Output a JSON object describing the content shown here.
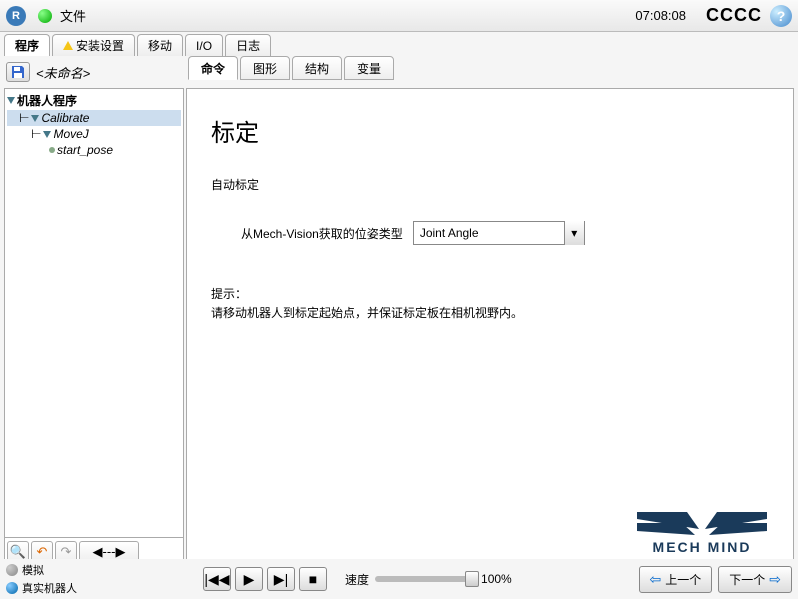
{
  "header": {
    "logo_text": "R",
    "file_label": "文件",
    "time": "07:08:08",
    "cccc": "CCCC",
    "help": "?"
  },
  "main_tabs": [
    "程序",
    "安装设置",
    "移动",
    "I/O",
    "日志"
  ],
  "unnamed": "<未命名>",
  "content_tabs": [
    "命令",
    "图形",
    "结构",
    "变量"
  ],
  "tree": {
    "root": "机器人程序",
    "node1": "Calibrate",
    "node2": "MoveJ",
    "node3": "start_pose"
  },
  "content": {
    "title": "标定",
    "subtitle": "自动标定",
    "field_label": "从Mech-Vision获取的位姿类型",
    "dropdown_value": "Joint Angle",
    "hint_label": "提示：",
    "hint_text": "请移动机器人到标定起始点，并保证标定板在相机视野内。"
  },
  "logo_text": "MECH MIND",
  "footer": {
    "simulate": "模拟",
    "real_robot": "真实机器人",
    "speed_label": "速度",
    "speed_value": "100%",
    "prev": "上一个",
    "next": "下一个"
  }
}
